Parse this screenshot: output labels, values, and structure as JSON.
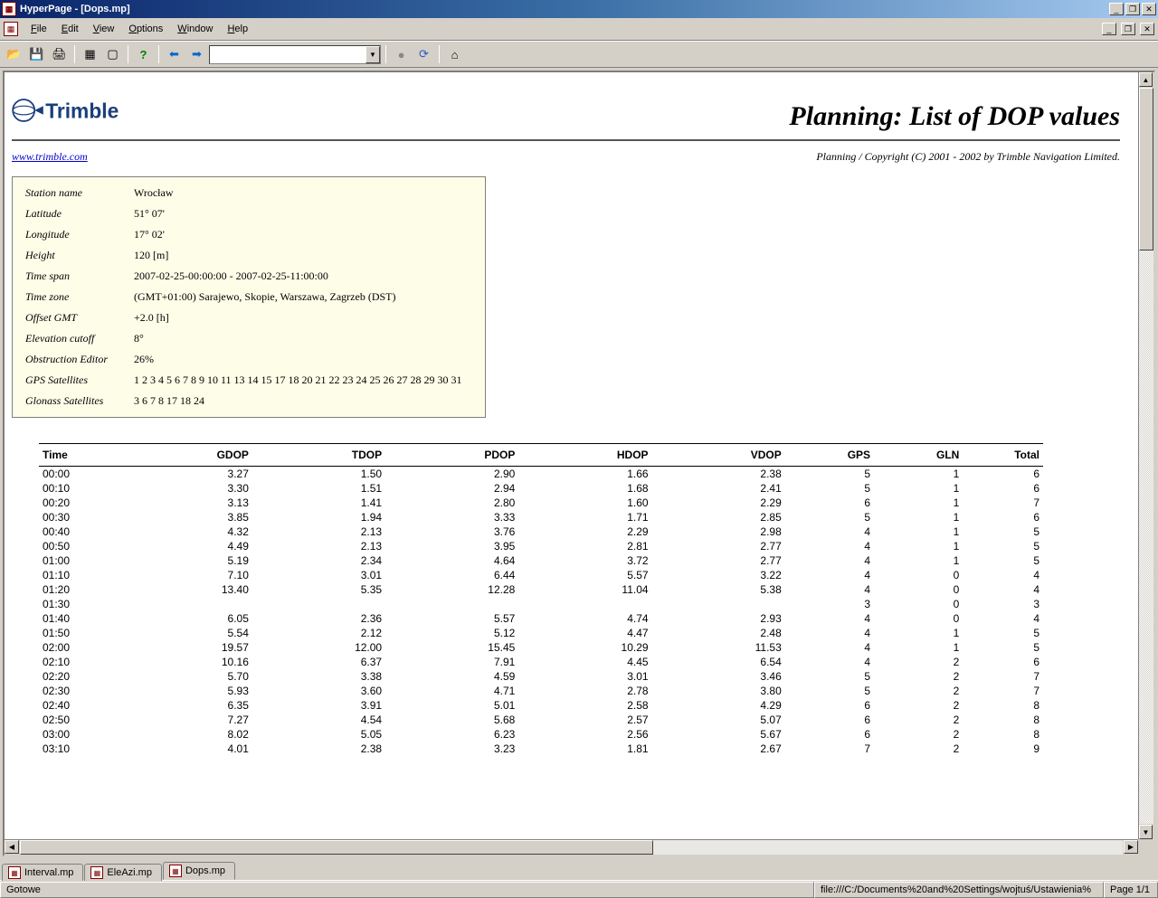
{
  "window": {
    "title": "HyperPage - [Dops.mp]"
  },
  "menu": [
    "File",
    "Edit",
    "View",
    "Options",
    "Window",
    "Help"
  ],
  "toolbar": {
    "combo_value": ""
  },
  "page": {
    "title": "Planning: List of DOP values",
    "link": "www.trimble.com",
    "copyright": "Planning / Copyright (C) 2001 - 2002 by Trimble Navigation Limited."
  },
  "info": {
    "station_name_lbl": "Station name",
    "station_name": "Wrocław",
    "latitude_lbl": "Latitude",
    "latitude": "51° 07'",
    "longitude_lbl": "Longitude",
    "longitude": "17° 02'",
    "height_lbl": "Height",
    "height": "120 [m]",
    "timespan_lbl": "Time span",
    "timespan": "2007-02-25-00:00:00 - 2007-02-25-11:00:00",
    "timezone_lbl": "Time zone",
    "timezone": "(GMT+01:00) Sarajewo, Skopie, Warszawa, Zagrzeb (DST)",
    "offset_lbl": "Offset GMT",
    "offset": "+2.0 [h]",
    "cutoff_lbl": "Elevation cutoff",
    "cutoff": "8°",
    "obstruction_lbl": "Obstruction Editor",
    "obstruction": "26%",
    "gps_lbl": "GPS Satellites",
    "gps": "1 2 3 4 5 6 7 8 9 10 11 13 14 15 17 18 20 21 22 23 24 25 26 27 28 29 30 31",
    "gln_lbl": "Glonass Satellites",
    "gln": "3 6 7 8 17 18 24"
  },
  "columns": [
    "Time",
    "GDOP",
    "TDOP",
    "PDOP",
    "HDOP",
    "VDOP",
    "GPS",
    "GLN",
    "Total"
  ],
  "rows": [
    [
      "00:00",
      "3.27",
      "1.50",
      "2.90",
      "1.66",
      "2.38",
      "5",
      "1",
      "6"
    ],
    [
      "00:10",
      "3.30",
      "1.51",
      "2.94",
      "1.68",
      "2.41",
      "5",
      "1",
      "6"
    ],
    [
      "00:20",
      "3.13",
      "1.41",
      "2.80",
      "1.60",
      "2.29",
      "6",
      "1",
      "7"
    ],
    [
      "00:30",
      "3.85",
      "1.94",
      "3.33",
      "1.71",
      "2.85",
      "5",
      "1",
      "6"
    ],
    [
      "00:40",
      "4.32",
      "2.13",
      "3.76",
      "2.29",
      "2.98",
      "4",
      "1",
      "5"
    ],
    [
      "00:50",
      "4.49",
      "2.13",
      "3.95",
      "2.81",
      "2.77",
      "4",
      "1",
      "5"
    ],
    [
      "01:00",
      "5.19",
      "2.34",
      "4.64",
      "3.72",
      "2.77",
      "4",
      "1",
      "5"
    ],
    [
      "01:10",
      "7.10",
      "3.01",
      "6.44",
      "5.57",
      "3.22",
      "4",
      "0",
      "4"
    ],
    [
      "01:20",
      "13.40",
      "5.35",
      "12.28",
      "11.04",
      "5.38",
      "4",
      "0",
      "4"
    ],
    [
      "01:30",
      "",
      "",
      "",
      "",
      "",
      "3",
      "0",
      "3"
    ],
    [
      "01:40",
      "6.05",
      "2.36",
      "5.57",
      "4.74",
      "2.93",
      "4",
      "0",
      "4"
    ],
    [
      "01:50",
      "5.54",
      "2.12",
      "5.12",
      "4.47",
      "2.48",
      "4",
      "1",
      "5"
    ],
    [
      "02:00",
      "19.57",
      "12.00",
      "15.45",
      "10.29",
      "11.53",
      "4",
      "1",
      "5"
    ],
    [
      "02:10",
      "10.16",
      "6.37",
      "7.91",
      "4.45",
      "6.54",
      "4",
      "2",
      "6"
    ],
    [
      "02:20",
      "5.70",
      "3.38",
      "4.59",
      "3.01",
      "3.46",
      "5",
      "2",
      "7"
    ],
    [
      "02:30",
      "5.93",
      "3.60",
      "4.71",
      "2.78",
      "3.80",
      "5",
      "2",
      "7"
    ],
    [
      "02:40",
      "6.35",
      "3.91",
      "5.01",
      "2.58",
      "4.29",
      "6",
      "2",
      "8"
    ],
    [
      "02:50",
      "7.27",
      "4.54",
      "5.68",
      "2.57",
      "5.07",
      "6",
      "2",
      "8"
    ],
    [
      "03:00",
      "8.02",
      "5.05",
      "6.23",
      "2.56",
      "5.67",
      "6",
      "2",
      "8"
    ],
    [
      "03:10",
      "4.01",
      "2.38",
      "3.23",
      "1.81",
      "2.67",
      "7",
      "2",
      "9"
    ]
  ],
  "tabs": [
    {
      "label": "Interval.mp",
      "active": false
    },
    {
      "label": "EleAzi.mp",
      "active": false
    },
    {
      "label": "Dops.mp",
      "active": true
    }
  ],
  "status": {
    "ready": "Gotowe",
    "path": "file:///C:/Documents%20and%20Settings/wojtuś/Ustawienia%",
    "page": "Page 1/1"
  }
}
